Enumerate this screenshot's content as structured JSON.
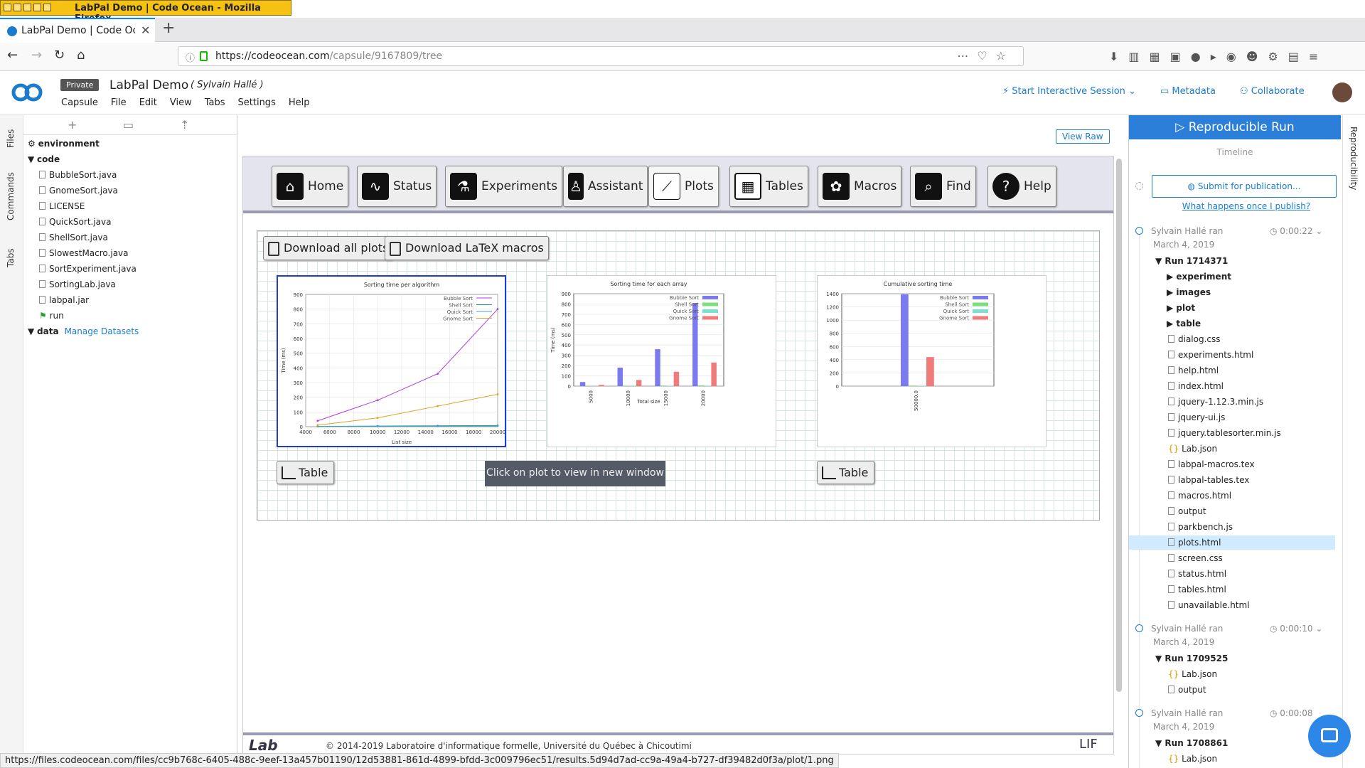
{
  "window": {
    "title": "LabPal Demo | Code Ocean - Mozilla Firefox"
  },
  "browser": {
    "tab_title": "LabPal Demo | Code Ocean",
    "url_host": "https://codeocean.com",
    "url_path": "/capsule/9167809/tree",
    "status_url": "https://files.codeocean.com/files/cc9b768c-6405-488c-9eef-13a457b01190/12d53881-861d-4899-bfdd-3c009796ec51/results.5d94d7ad-cc9a-49a4-b727-df39482d0f3a/plot/1.png"
  },
  "app": {
    "private_badge": "Private",
    "capsule_title": "LabPal Demo",
    "author": "( Sylvain Hallé )",
    "menu": [
      "Capsule",
      "File",
      "Edit",
      "View",
      "Tabs",
      "Settings",
      "Help"
    ],
    "start_session": "Start Interactive Session",
    "metadata": "Metadata",
    "collaborate": "Collaborate",
    "accent": "#1b7ccd"
  },
  "left_tabs": [
    "Files",
    "Commands",
    "Tabs"
  ],
  "file_tree": {
    "environment": "environment",
    "code": "code",
    "files": [
      "BubbleSort.java",
      "GnomeSort.java",
      "LICENSE",
      "QuickSort.java",
      "ShellSort.java",
      "SlowestMacro.java",
      "SortExperiment.java",
      "SortingLab.java",
      "labpal.jar",
      "run"
    ],
    "data": "data",
    "manage_datasets": "Manage Datasets"
  },
  "center": {
    "view_raw": "View Raw",
    "nav": [
      "Home",
      "Status",
      "Experiments",
      "Assistant",
      "Plots",
      "Tables",
      "Macros",
      "Find",
      "Help"
    ],
    "download_plots": "Download all plots",
    "download_macros": "Download LaTeX macros",
    "table_btn": "Table",
    "tooltip": "Click on plot to view in new window",
    "footer": "© 2014-2019 Laboratoire d'informatique formelle, Université du Québec à Chicoutimi"
  },
  "chart_data": [
    {
      "type": "line",
      "title": "Sorting time per algorithm",
      "xlabel": "List size",
      "ylabel": "Time (ms)",
      "xlim": [
        4000,
        20000
      ],
      "ylim": [
        0,
        900
      ],
      "xticks": [
        4000,
        6000,
        8000,
        10000,
        12000,
        14000,
        16000,
        18000,
        20000
      ],
      "yticks": [
        0,
        100,
        200,
        300,
        400,
        500,
        600,
        700,
        800,
        900
      ],
      "x": [
        5000,
        10000,
        15000,
        20000
      ],
      "series": [
        {
          "name": "Bubble Sort",
          "color": "#b03fd9",
          "values": [
            40,
            180,
            360,
            800
          ]
        },
        {
          "name": "Shell Sort",
          "color": "#1f9e6a",
          "values": [
            2,
            4,
            6,
            8
          ]
        },
        {
          "name": "Quick Sort",
          "color": "#3fa0d9",
          "values": [
            1,
            2,
            3,
            4
          ]
        },
        {
          "name": "Gnome Sort",
          "color": "#e0a020",
          "values": [
            10,
            60,
            140,
            220
          ]
        }
      ]
    },
    {
      "type": "bar",
      "title": "Sorting time for each array",
      "xlabel": "Total size",
      "ylabel": "Time (ms)",
      "ylim": [
        0,
        900
      ],
      "yticks": [
        0,
        100,
        200,
        300,
        400,
        500,
        600,
        700,
        800,
        900
      ],
      "categories": [
        "5000",
        "10000",
        "15000",
        "20000"
      ],
      "series": [
        {
          "name": "Bubble Sort",
          "color": "#7b7bef",
          "values": [
            40,
            180,
            360,
            810
          ]
        },
        {
          "name": "Shell Sort",
          "color": "#7be07b",
          "values": [
            2,
            4,
            6,
            8
          ]
        },
        {
          "name": "Quick Sort",
          "color": "#7be0d0",
          "values": [
            1,
            2,
            3,
            4
          ]
        },
        {
          "name": "Gnome Sort",
          "color": "#ef7b7b",
          "values": [
            12,
            60,
            140,
            230
          ]
        }
      ]
    },
    {
      "type": "bar",
      "title": "Cumulative sorting time",
      "xlabel": "",
      "ylabel": "",
      "ylim": [
        0,
        1400
      ],
      "yticks": [
        0,
        200,
        400,
        600,
        800,
        1000,
        1200,
        1400
      ],
      "categories": [
        "50000.0"
      ],
      "series": [
        {
          "name": "Bubble Sort",
          "color": "#7b7bef",
          "values": [
            1390
          ]
        },
        {
          "name": "Shell Sort",
          "color": "#7be07b",
          "values": [
            8
          ]
        },
        {
          "name": "Quick Sort",
          "color": "#7be0d0",
          "values": [
            6
          ]
        },
        {
          "name": "Gnome Sort",
          "color": "#ef7b7b",
          "values": [
            440
          ]
        }
      ]
    }
  ],
  "right": {
    "repro_run": "Reproducible Run",
    "timeline": "Timeline",
    "submit": "Submit for publication...",
    "what_happens": "What happens once I publish?",
    "vertical_tab": "Reproducibility",
    "runs": [
      {
        "who": "Sylvain Hallé ran",
        "duration": "0:00:22",
        "date": "March 4, 2019",
        "run": "Run 1714371",
        "folders": [
          "experiment",
          "images",
          "plot",
          "table"
        ],
        "files": [
          "dialog.css",
          "experiments.html",
          "help.html",
          "index.html",
          "jquery-1.12.3.min.js",
          "jquery-ui.js",
          "jquery.tablesorter.min.js",
          "Lab.json",
          "labpal-macros.tex",
          "labpal-tables.tex",
          "macros.html",
          "output",
          "parkbench.js",
          "plots.html",
          "screen.css",
          "status.html",
          "tables.html",
          "unavailable.html"
        ]
      },
      {
        "who": "Sylvain Hallé ran",
        "duration": "0:00:10",
        "date": "March 4, 2019",
        "run": "Run 1709525",
        "files": [
          "Lab.json",
          "output"
        ]
      },
      {
        "who": "Sylvain Hallé ran",
        "duration": "0:00:08",
        "date": "March 4, 2019",
        "run": "Run 1708861",
        "files": [
          "Lab.json"
        ]
      }
    ]
  }
}
